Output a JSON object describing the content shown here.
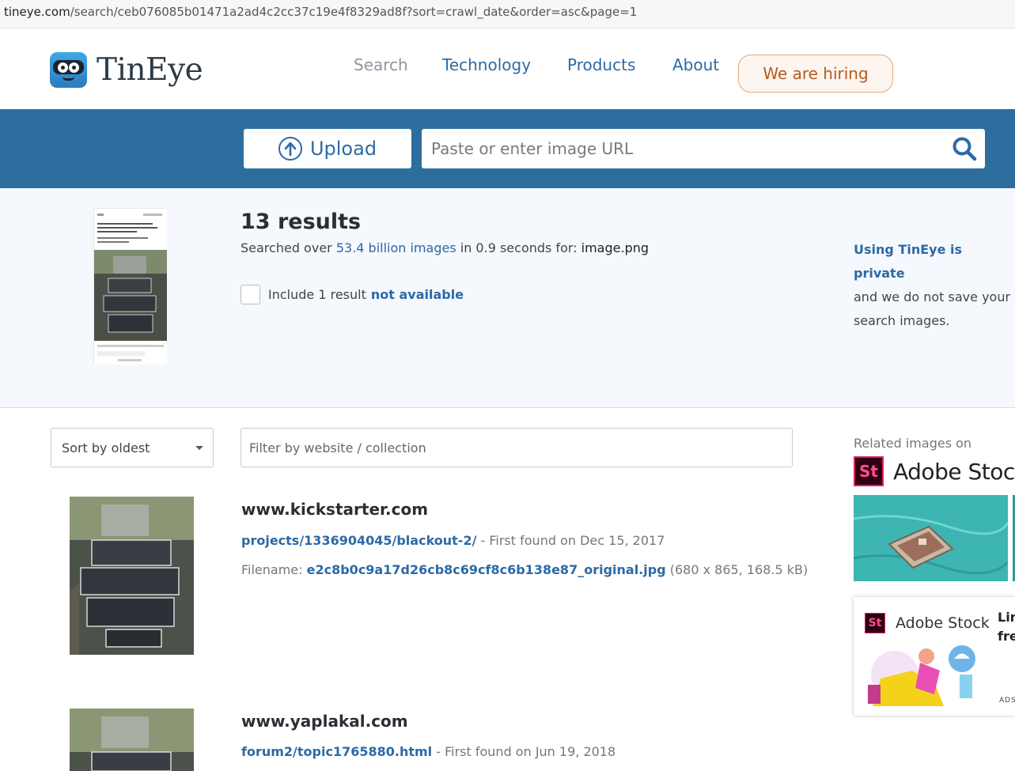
{
  "browser": {
    "url_host": "tineye.com",
    "url_path": "/search/ceb076085b01471a2ad4c2cc37c19e4f8329ad8f?sort=crawl_date&order=asc&page=1"
  },
  "header": {
    "logo_text": "TinEye",
    "nav": {
      "search": "Search",
      "technology": "Technology",
      "products": "Products",
      "about": "About",
      "hiring": "We are hiring"
    }
  },
  "search_bar": {
    "upload_label": "Upload",
    "url_placeholder": "Paste or enter image URL"
  },
  "summary": {
    "results_count": "13 results",
    "searched_prefix": "Searched over ",
    "searched_link": "53.4 billion images",
    "searched_mid": " in 0.9 seconds for: ",
    "filename": "image.png",
    "include_prefix": "Include 1 result ",
    "include_link": "not available",
    "private_title": "Using TinEye is private",
    "private_text": "and we do not save your search images."
  },
  "filters": {
    "sort_selected": "Sort by oldest",
    "filter_placeholder": "Filter by website / collection"
  },
  "results": [
    {
      "site": "www.kickstarter.com",
      "path": "projects/1336904045/blackout-2/",
      "found": " - First found on Dec 15, 2017",
      "filename_label": "Filename: ",
      "filename": "e2c8b0c9a17d26cb8c69cf8c6b138e87_original.jpg",
      "meta": " (680 x 865, 168.5 kB)"
    },
    {
      "site": "www.yaplakal.com",
      "path": "forum2/topic1765880.html",
      "found": " - First found on Jun 19, 2018"
    }
  ],
  "ads": {
    "related_label": "Related images on",
    "brand": "Adobe Stock",
    "st_mark": "St",
    "card_brand": "Adobe Stock",
    "card_copy_line1": "Lin",
    "card_copy_line2": "fre",
    "ads_label": "ADS"
  }
}
